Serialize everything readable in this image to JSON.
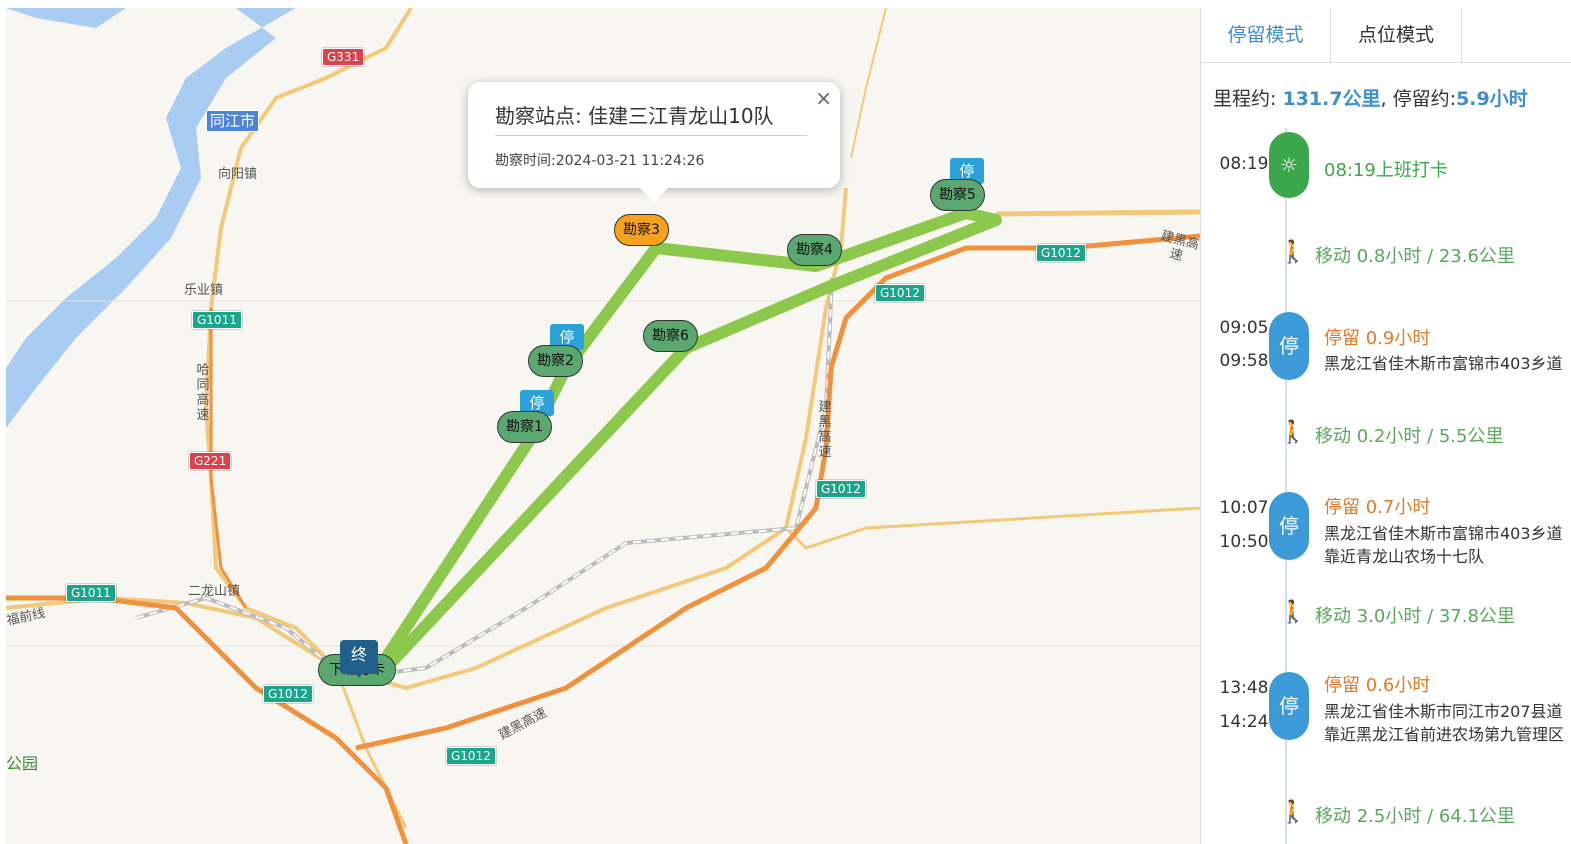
{
  "map": {
    "city_labels": [
      "同江市"
    ],
    "town_labels": [
      "向阳镇",
      "乐业镇",
      "二龙山镇"
    ],
    "road_labels": [
      "建黑高速",
      "建黑高速",
      "建黑高速",
      "哈同高速",
      "福前线"
    ],
    "shields": [
      {
        "text": "G331",
        "color": "red"
      },
      {
        "text": "G1011",
        "color": "green"
      },
      {
        "text": "G221",
        "color": "red"
      },
      {
        "text": "G1011",
        "color": "green"
      },
      {
        "text": "G1012",
        "color": "green"
      },
      {
        "text": "G1012",
        "color": "green"
      },
      {
        "text": "G1012",
        "color": "green"
      },
      {
        "text": "G1012",
        "color": "green"
      },
      {
        "text": "G1012",
        "color": "green"
      }
    ],
    "park_label": "公园",
    "stop_tag": "停",
    "end_marker": "终",
    "end_pin": "下班打卡",
    "markers": [
      "勘察1",
      "勘察2",
      "勘察3",
      "勘察4",
      "勘察5",
      "勘察6"
    ],
    "route_color": "#8cc84b",
    "popup": {
      "title": "勘察站点:  佳建三江青龙山10队",
      "time": "勘察时间:2024-03-21 11:24:26",
      "close": "×"
    }
  },
  "panel": {
    "tabs": [
      "停留模式",
      "点位模式"
    ],
    "summary": {
      "mileage_label": "里程约:",
      "mileage_value": "131.7公里",
      "sep": ",",
      "stay_label": "停留约:",
      "stay_value": "5.9小时"
    },
    "checkin": {
      "time": "08:19",
      "title": "08:19上班打卡"
    },
    "moves": [
      "移动 0.8小时 / 23.6公里",
      "移动 0.2小时 / 5.5公里",
      "移动 3.0小时 / 37.8公里",
      "移动 2.5小时 / 64.1公里"
    ],
    "stays": [
      {
        "start": "09:05",
        "end": "09:58",
        "badge": "停",
        "title": "停留 0.9小时",
        "address": "黑龙江省佳木斯市富锦市403乡道"
      },
      {
        "start": "10:07",
        "end": "10:50",
        "badge": "停",
        "title": "停留 0.7小时",
        "address": "黑龙江省佳木斯市富锦市403乡道靠近青龙山农场十七队"
      },
      {
        "start": "13:48",
        "end": "14:24",
        "badge": "停",
        "title": "停留 0.6小时",
        "address": "黑龙江省佳木斯市同江市207县道靠近黑龙江省前进农场第九管理区"
      }
    ]
  }
}
